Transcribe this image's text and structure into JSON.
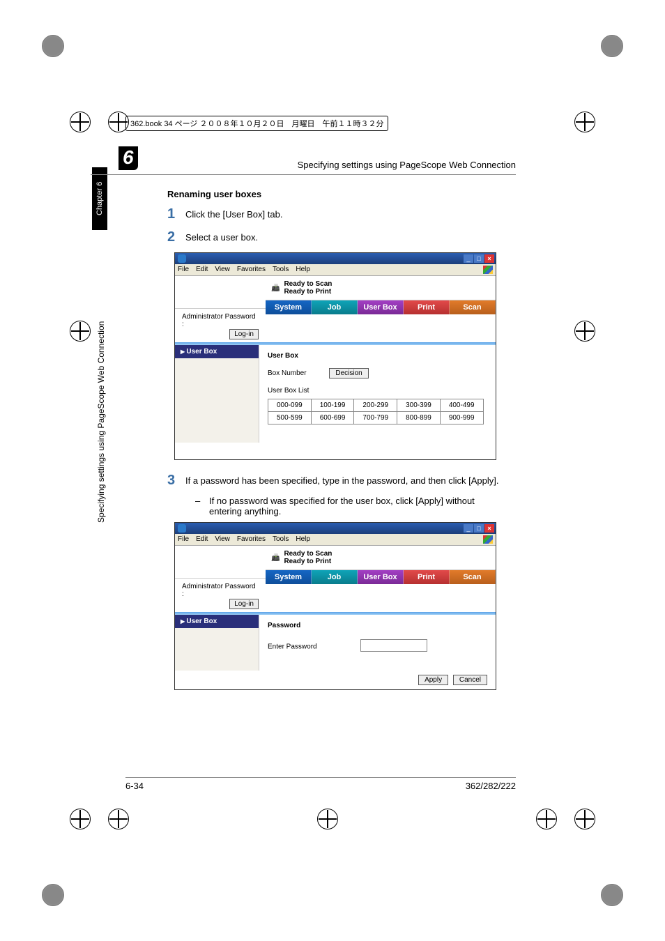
{
  "meta_line": "362.book  34 ページ  ２００８年１０月２０日　月曜日　午前１１時３２分",
  "running_head": {
    "chapter_number": "6",
    "title": "Specifying settings using PageScope Web Connection"
  },
  "side_tab": "Chapter 6",
  "side_text": "Specifying settings using PageScope Web Connection",
  "section_title": "Renaming user boxes",
  "steps": {
    "s1": {
      "num": "1",
      "text": "Click the [User Box] tab."
    },
    "s2": {
      "num": "2",
      "text": "Select a user box."
    },
    "s3": {
      "num": "3",
      "text": "If a password has been specified, type in the password, and then click [Apply]."
    }
  },
  "sub_bullet": {
    "dash": "–",
    "text": "If no password was specified for the user box, click [Apply] without entering anything."
  },
  "screenshot_common": {
    "menus": {
      "file": "File",
      "edit": "Edit",
      "view": "View",
      "favorites": "Favorites",
      "tools": "Tools",
      "help": "Help"
    },
    "status_scan": "Ready to Scan",
    "status_print": "Ready to Print",
    "admin_label": "Administrator Password :",
    "login_btn": "Log-in",
    "tabs": {
      "system": "System",
      "job": "Job",
      "userbox": "User Box",
      "print": "Print",
      "scan": "Scan"
    },
    "nav_item": "User Box"
  },
  "screenshot1": {
    "main_title": "User Box",
    "box_number_label": "Box Number",
    "decision_btn": "Decision",
    "list_title": "User Box List",
    "grid": [
      [
        "000-099",
        "100-199",
        "200-299",
        "300-399",
        "400-499"
      ],
      [
        "500-599",
        "600-699",
        "700-799",
        "800-899",
        "900-999"
      ]
    ]
  },
  "screenshot2": {
    "main_title": "Password",
    "enter_pw_label": "Enter Password",
    "apply_btn": "Apply",
    "cancel_btn": "Cancel"
  },
  "footer": {
    "left": "6-34",
    "right": "362/282/222"
  }
}
